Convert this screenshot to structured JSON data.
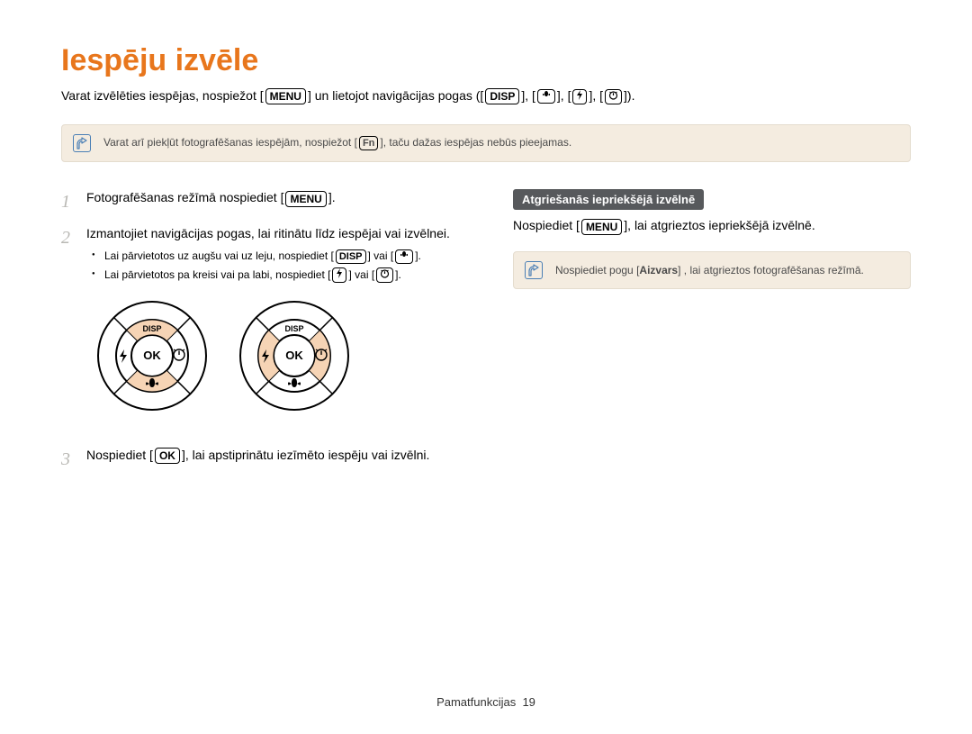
{
  "title": "Iespēju izvēle",
  "intro": {
    "p1_a": "Varat izvēlēties iespējas, nospiežot [",
    "menu_label": "MENU",
    "p1_b": "] un lietojot navigācijas pogas ([",
    "disp_label": "DISP",
    "p1_c": "], [",
    "p1_d": "], [",
    "p1_e": "], [",
    "p1_f": "])."
  },
  "note1": {
    "a": "Varat arī piekļūt fotografēšanas iespējām, nospiežot [",
    "fn_label": "Fn",
    "b": "], taču dažas iespējas nebūs pieejamas."
  },
  "steps": {
    "s1": {
      "num": "1",
      "a": "Fotografēšanas režīmā nospiediet [",
      "b": "]."
    },
    "s2": {
      "num": "2",
      "text": "Izmantojiet navigācijas pogas, lai ritinātu līdz iespējai vai izvēlnei."
    },
    "s3": {
      "num": "3",
      "a": "Nospiediet [",
      "ok_label": "OK",
      "b": "], lai apstiprinātu iezīmēto iespēju vai izvēlni."
    }
  },
  "bullets": {
    "b1": {
      "a": "Lai pārvietotos uz augšu vai uz leju, nospiediet [",
      "b": "] vai [",
      "c": "]."
    },
    "b2": {
      "a": "Lai pārvietotos pa kreisi vai pa labi, nospiediet [",
      "b": "] vai [",
      "c": "]."
    }
  },
  "dial": {
    "disp": "DISP",
    "ok": "OK"
  },
  "right": {
    "subhead": "Atgriešanās iepriekšējā izvēlnē",
    "p_a": "Nospiediet [",
    "p_b": "], lai atgrieztos iepriekšējā izvēlnē."
  },
  "note2": {
    "a": "Nospiediet pogu [",
    "shutter": "Aizvars",
    "b": "] , lai atgrieztos fotografēšanas režīmā."
  },
  "footer": {
    "section": "Pamatfunkcijas",
    "page": "19"
  }
}
